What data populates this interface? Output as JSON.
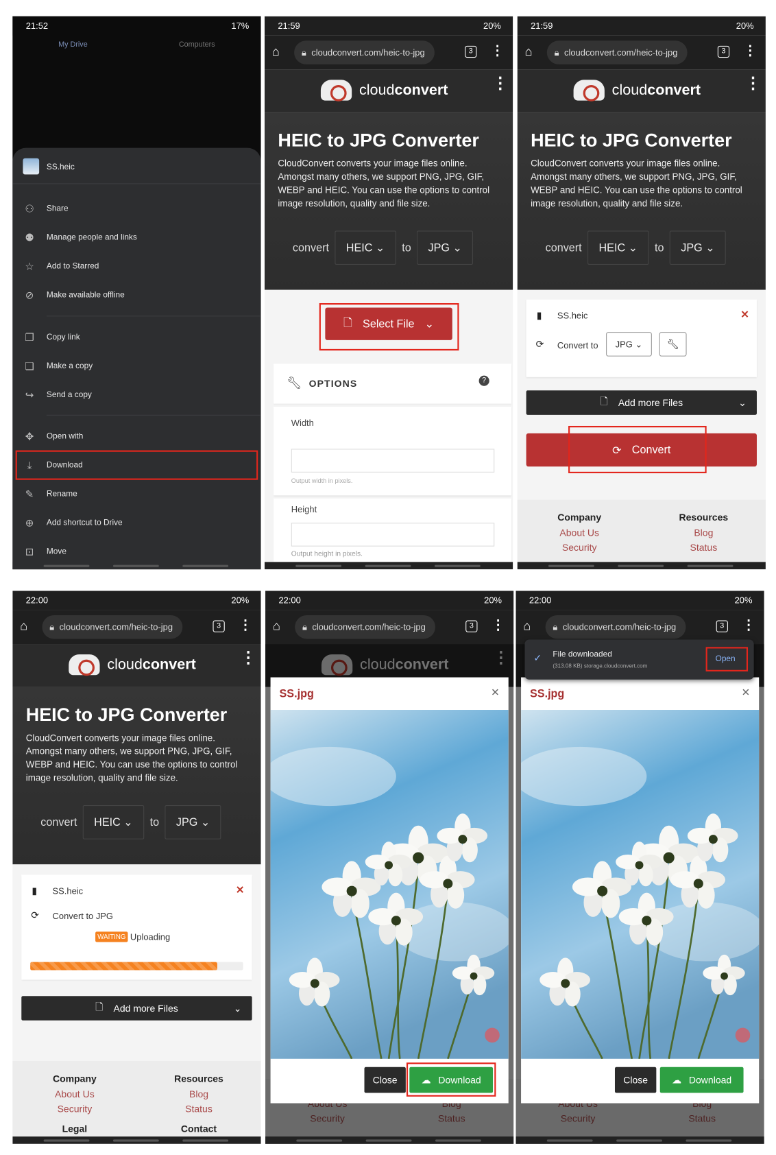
{
  "screens": [
    {
      "time": "21:52",
      "battery": "17%"
    },
    {
      "time": "21:59",
      "battery": "20%"
    },
    {
      "time": "21:59",
      "battery": "20%"
    },
    {
      "time": "22:00",
      "battery": "20%"
    },
    {
      "time": "22:00",
      "battery": "20%"
    },
    {
      "time": "22:00",
      "battery": "20%"
    }
  ],
  "drive": {
    "tabs": [
      "My Drive",
      "Computers"
    ],
    "file": "SS.heic",
    "menu": [
      {
        "label": "Share",
        "icon": "person-add-icon"
      },
      {
        "label": "Manage people and links",
        "icon": "people-icon"
      },
      {
        "label": "Add to Starred",
        "icon": "star-icon"
      },
      {
        "label": "Make available offline",
        "icon": "offline-icon"
      },
      {
        "label": "Copy link",
        "icon": "link-icon"
      },
      {
        "label": "Make a copy",
        "icon": "copy-icon"
      },
      {
        "label": "Send a copy",
        "icon": "send-icon"
      },
      {
        "label": "Open with",
        "icon": "open-with-icon"
      },
      {
        "label": "Download",
        "icon": "download-icon"
      },
      {
        "label": "Rename",
        "icon": "rename-icon"
      },
      {
        "label": "Add shortcut to Drive",
        "icon": "shortcut-icon"
      },
      {
        "label": "Move",
        "icon": "move-icon"
      }
    ],
    "highlighted": "Download"
  },
  "browser": {
    "url": "cloudconvert.com/heic-to-jpg",
    "tab_count": "3"
  },
  "site": {
    "brand_light": "cloud",
    "brand_bold": "convert",
    "title": "HEIC to JPG Converter",
    "description": "CloudConvert converts your image files online. Amongst many others, we support PNG, JPG, GIF, WEBP and HEIC. You can use the options to control image resolution, quality and file size.",
    "convert_label": "convert",
    "from": "HEIC",
    "to_label": "to",
    "to": "JPG"
  },
  "select_file": "Select File",
  "options": {
    "heading": "OPTIONS",
    "width_label": "Width",
    "width_value": "",
    "width_hint": "Output width in pixels.",
    "height_label": "Height",
    "height_value": "",
    "height_hint": "Output height in pixels."
  },
  "file_card": {
    "name": "SS.heic",
    "convert_to_label": "Convert to",
    "format": "JPG",
    "convert_to_full": "Convert to JPG",
    "status_badge": "WAITING",
    "status_text": "Uploading",
    "progress_percent": 88
  },
  "add_more": "Add more Files",
  "convert_button": "Convert",
  "footer": {
    "company": "Company",
    "resources": "Resources",
    "about": "About Us",
    "security": "Security",
    "blog": "Blog",
    "status": "Status",
    "legal": "Legal",
    "contact": "Contact"
  },
  "preview": {
    "filename": "SS.jpg",
    "close": "Close",
    "download": "Download"
  },
  "notification": {
    "title": "File downloaded",
    "detail": "(313.08 KB) storage.cloudconvert.com",
    "action": "Open"
  },
  "colors": {
    "accent": "#b83232",
    "highlight": "#e3261c",
    "download_green": "#2ea043",
    "progress": "#f58220"
  }
}
